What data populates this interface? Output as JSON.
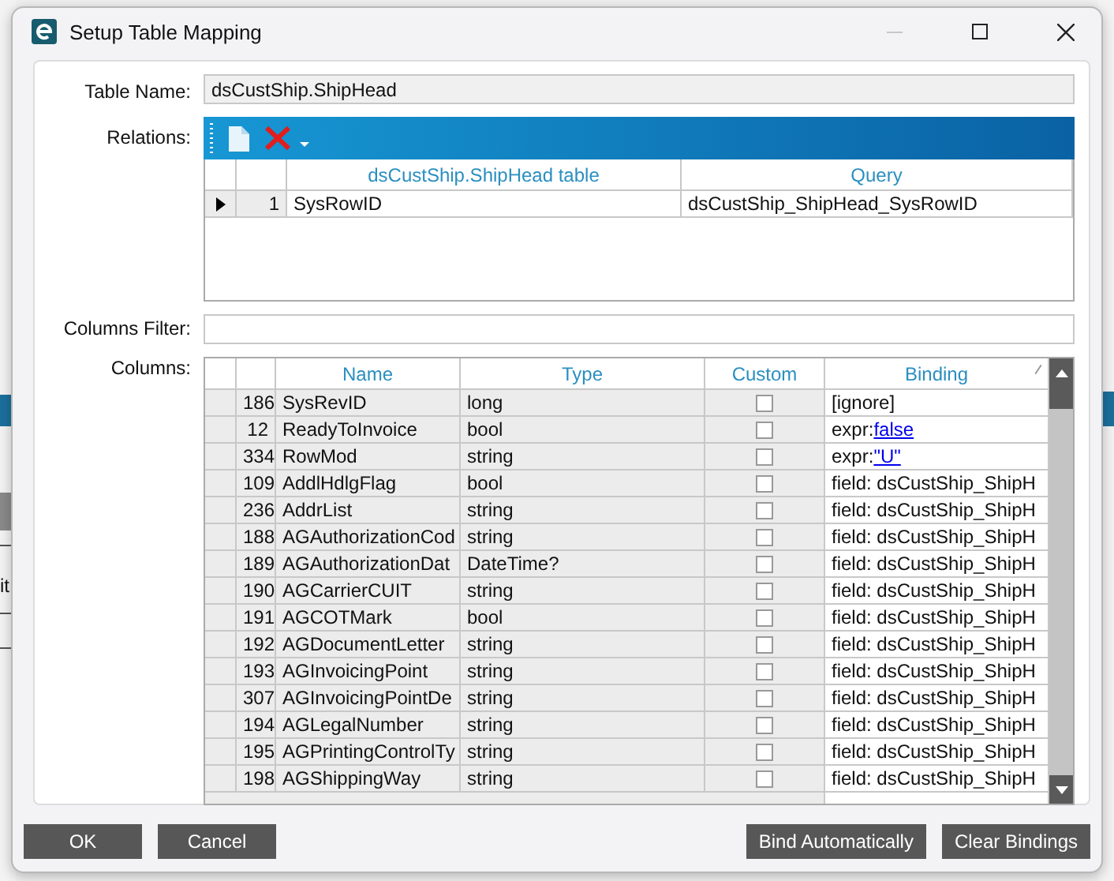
{
  "window": {
    "title": "Setup Table Mapping"
  },
  "backdrop_text": "it",
  "table_name": {
    "label": "Table Name:",
    "value": "dsCustShip.ShipHead"
  },
  "relations": {
    "label": "Relations:",
    "columns": [
      "dsCustShip.ShipHead table",
      "Query"
    ],
    "rows": [
      {
        "selected": true,
        "number": "1",
        "table": "SysRowID",
        "query": "dsCustShip_ShipHead_SysRowID"
      }
    ]
  },
  "columns_filter": {
    "label": "Columns Filter:"
  },
  "columns": {
    "label": "Columns:",
    "headers": [
      "Name",
      "Type",
      "Custom",
      "Binding"
    ],
    "rows": [
      {
        "number": "186",
        "name": "SysRevID",
        "type": "long",
        "checked": false,
        "binding": "[ignore]"
      },
      {
        "number": "12",
        "name": "ReadyToInvoice",
        "type": "bool",
        "checked": false,
        "binding": "expr:",
        "binding_link": "false"
      },
      {
        "number": "334",
        "name": "RowMod",
        "type": "string",
        "checked": false,
        "binding": "expr:",
        "binding_link": "\"U\""
      },
      {
        "number": "109",
        "name": "AddlHdlgFlag",
        "type": "bool",
        "checked": false,
        "binding": "field: dsCustShip_ShipH"
      },
      {
        "number": "236",
        "name": "AddrList",
        "type": "string",
        "checked": false,
        "binding": "field: dsCustShip_ShipH"
      },
      {
        "number": "188",
        "name": "AGAuthorizationCod",
        "type": "string",
        "checked": false,
        "binding": "field: dsCustShip_ShipH"
      },
      {
        "number": "189",
        "name": "AGAuthorizationDat",
        "type": "DateTime?",
        "checked": false,
        "binding": "field: dsCustShip_ShipH"
      },
      {
        "number": "190",
        "name": "AGCarrierCUIT",
        "type": "string",
        "checked": false,
        "binding": "field: dsCustShip_ShipH"
      },
      {
        "number": "191",
        "name": "AGCOTMark",
        "type": "bool",
        "checked": false,
        "binding": "field: dsCustShip_ShipH"
      },
      {
        "number": "192",
        "name": "AGDocumentLetter",
        "type": "string",
        "checked": false,
        "binding": "field: dsCustShip_ShipH"
      },
      {
        "number": "193",
        "name": "AGInvoicingPoint",
        "type": "string",
        "checked": false,
        "binding": "field: dsCustShip_ShipH"
      },
      {
        "number": "307",
        "name": "AGInvoicingPointDe",
        "type": "string",
        "checked": false,
        "binding": "field: dsCustShip_ShipH"
      },
      {
        "number": "194",
        "name": "AGLegalNumber",
        "type": "string",
        "checked": false,
        "binding": "field: dsCustShip_ShipH"
      },
      {
        "number": "195",
        "name": "AGPrintingControlTy",
        "type": "string",
        "checked": false,
        "binding": "field: dsCustShip_ShipH"
      },
      {
        "number": "198",
        "name": "AGShippingWay",
        "type": "string",
        "checked": false,
        "binding": "field: dsCustShip_ShipH"
      }
    ]
  },
  "buttons_left": [
    "OK",
    "Cancel"
  ],
  "buttons_right": [
    "Bind Automatically",
    "Clear Bindings"
  ]
}
